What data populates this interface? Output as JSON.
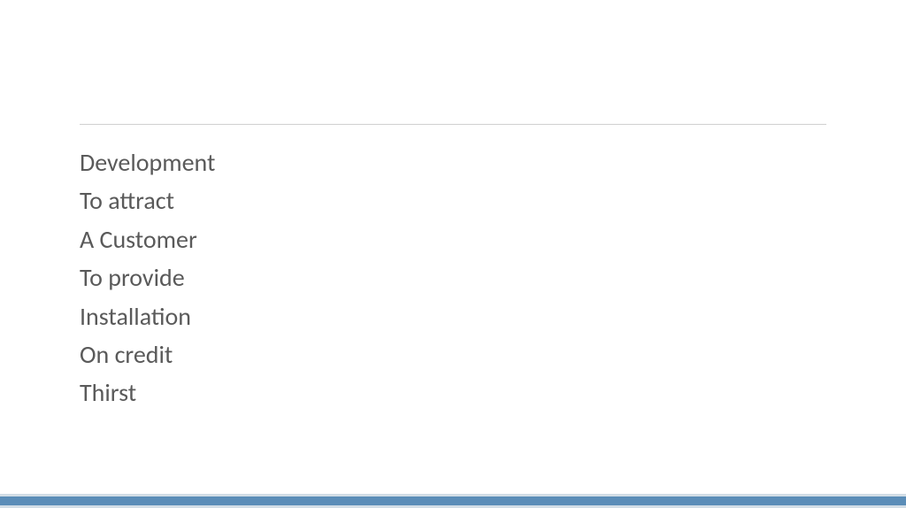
{
  "lines": [
    "Development",
    "To attract",
    "A Customer",
    "To provide",
    "Installation",
    "On credit",
    "Thirst"
  ]
}
